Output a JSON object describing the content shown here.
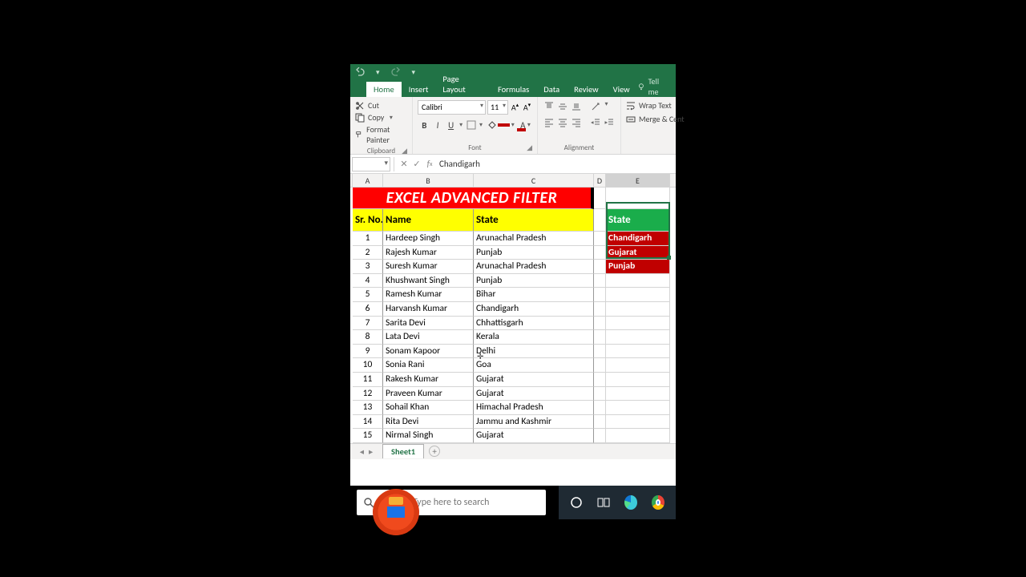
{
  "qat": {
    "undo_tip": "Undo",
    "redo_tip": "Redo"
  },
  "tabs": {
    "home": "Home",
    "insert": "Insert",
    "pagelayout": "Page Layout",
    "formulas": "Formulas",
    "data": "Data",
    "review": "Review",
    "view": "View",
    "tellme": "Tell me"
  },
  "ribbon": {
    "clipboard": {
      "cut": "Cut",
      "copy": "Copy",
      "paint": "Format Painter",
      "label": "Clipboard"
    },
    "font": {
      "name": "Calibri",
      "size": "11",
      "label": "Font"
    },
    "alignment": {
      "wrap": "Wrap Text",
      "merge": "Merge & Cent",
      "label": "Alignment"
    }
  },
  "formula_bar": {
    "value": "Chandigarh"
  },
  "columns": [
    "A",
    "B",
    "C",
    "D",
    "E"
  ],
  "title_cell": "EXCEL ADVANCED FILTER",
  "headers": {
    "sr": "Sr. No.",
    "name": "Name",
    "state": "State"
  },
  "criteria": {
    "header": "State",
    "values": [
      "Chandigarh",
      "Gujarat",
      "Punjab"
    ]
  },
  "rows": [
    {
      "n": "1",
      "name": "Hardeep Singh",
      "state": "Arunachal Pradesh"
    },
    {
      "n": "2",
      "name": "Rajesh Kumar",
      "state": "Punjab"
    },
    {
      "n": "3",
      "name": "Suresh Kumar",
      "state": "Arunachal Pradesh"
    },
    {
      "n": "4",
      "name": "Khushwant Singh",
      "state": "Punjab"
    },
    {
      "n": "5",
      "name": "Ramesh Kumar",
      "state": "Bihar"
    },
    {
      "n": "6",
      "name": "Harvansh Kumar",
      "state": "Chandigarh"
    },
    {
      "n": "7",
      "name": "Sarita Devi",
      "state": "Chhattisgarh"
    },
    {
      "n": "8",
      "name": "Lata Devi",
      "state": "Kerala"
    },
    {
      "n": "9",
      "name": "Sonam Kapoor",
      "state": "Delhi"
    },
    {
      "n": "10",
      "name": "Sonia Rani",
      "state": "Goa"
    },
    {
      "n": "11",
      "name": "Rakesh Kumar",
      "state": "Gujarat"
    },
    {
      "n": "12",
      "name": "Praveen Kumar",
      "state": "Gujarat"
    },
    {
      "n": "13",
      "name": "Sohail Khan",
      "state": "Himachal Pradesh"
    },
    {
      "n": "14",
      "name": "Rita Devi",
      "state": "Jammu and Kashmir"
    },
    {
      "n": "15",
      "name": "Nirmal Singh",
      "state": "Gujarat"
    }
  ],
  "sheet": {
    "name": "Sheet1"
  },
  "taskbar": {
    "search_placeholder": "Type here to search"
  }
}
